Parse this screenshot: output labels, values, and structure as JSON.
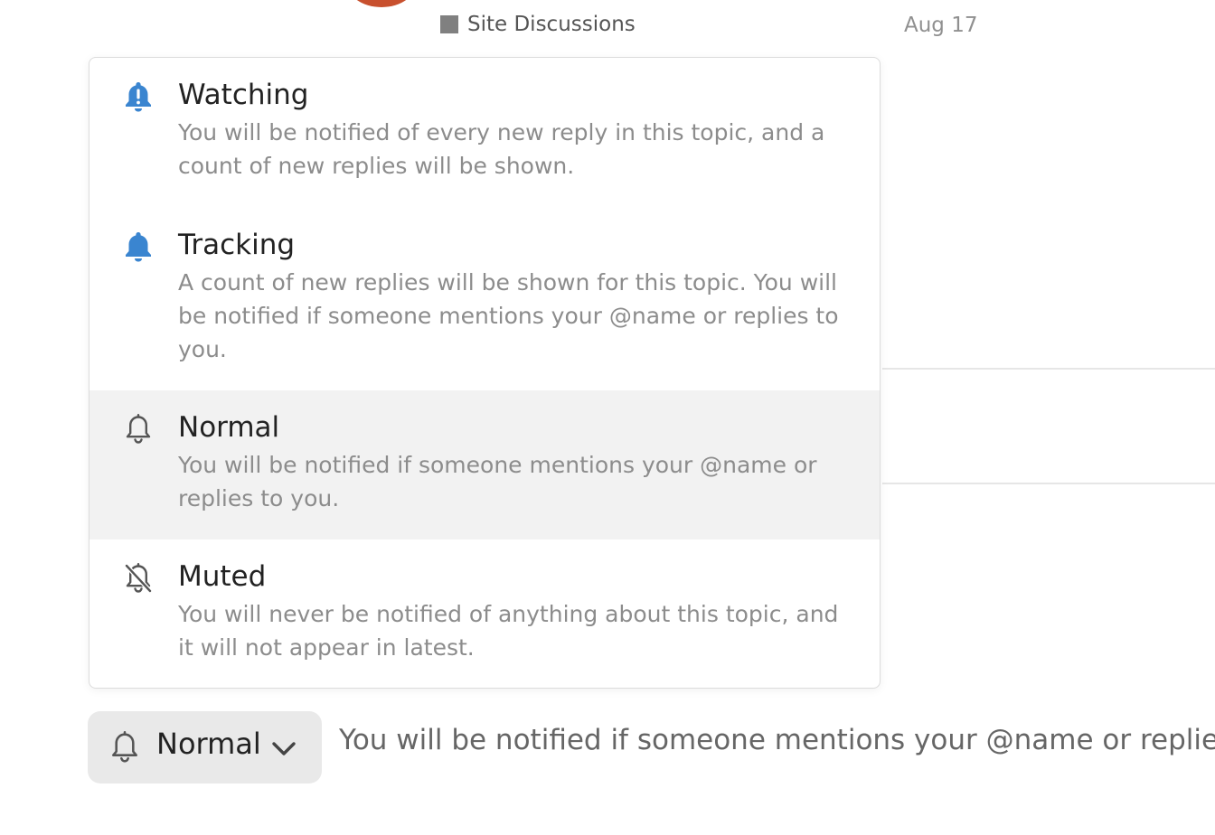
{
  "topic_meta": {
    "category": "Site Discussions",
    "date": "Aug 17",
    "category_color": "#808080"
  },
  "notification_menu": {
    "options": [
      {
        "title": "Watching",
        "description": "You will be notified of every new reply in this topic, and a count of new replies will be shown.",
        "icon": "bell-exclamation-icon",
        "icon_color": "#3a85d0"
      },
      {
        "title": "Tracking",
        "description": "A count of new replies will be shown for this topic. You will be notified if someone mentions your @name or replies to you.",
        "icon": "bell-icon",
        "icon_color": "#3a85d0"
      },
      {
        "title": "Normal",
        "description": "You will be notified if someone mentions your @name or replies to you.",
        "icon": "bell-outline-icon",
        "icon_color": "#555555",
        "selected": true
      },
      {
        "title": "Muted",
        "description": "You will never be notified of anything about this topic, and it will not appear in latest.",
        "icon": "bell-slash-icon",
        "icon_color": "#555555"
      }
    ]
  },
  "notification_button": {
    "label": "Normal",
    "reason": "You will be notified if someone mentions your @name or replies to you."
  }
}
